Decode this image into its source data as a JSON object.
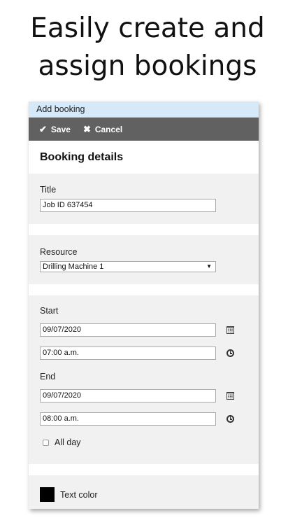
{
  "headline": {
    "line1": "Easily create and",
    "line2": "assign bookings"
  },
  "dialog": {
    "title": "Add booking",
    "toolbar": {
      "save_label": "Save",
      "cancel_label": "Cancel"
    },
    "section_title": "Booking details",
    "title_field": {
      "label": "Title",
      "value": "Job ID 637454"
    },
    "resource_field": {
      "label": "Resource",
      "selected": "Drilling Machine 1"
    },
    "start": {
      "label": "Start",
      "date": "09/07/2020",
      "time": "07:00 a.m."
    },
    "end": {
      "label": "End",
      "date": "09/07/2020",
      "time": "08:00 a.m."
    },
    "all_day_label": "All day",
    "text_color": {
      "label": "Text color",
      "color": "#000000"
    }
  },
  "icons": {
    "save": "check-icon",
    "cancel": "x-icon",
    "date": "calendar-icon",
    "time": "clock-icon",
    "dropdown": "caret-down-icon"
  },
  "colors": {
    "dialog_header": "#d6e9f8",
    "toolbar": "#616161",
    "panel": "#f1f1f1"
  }
}
